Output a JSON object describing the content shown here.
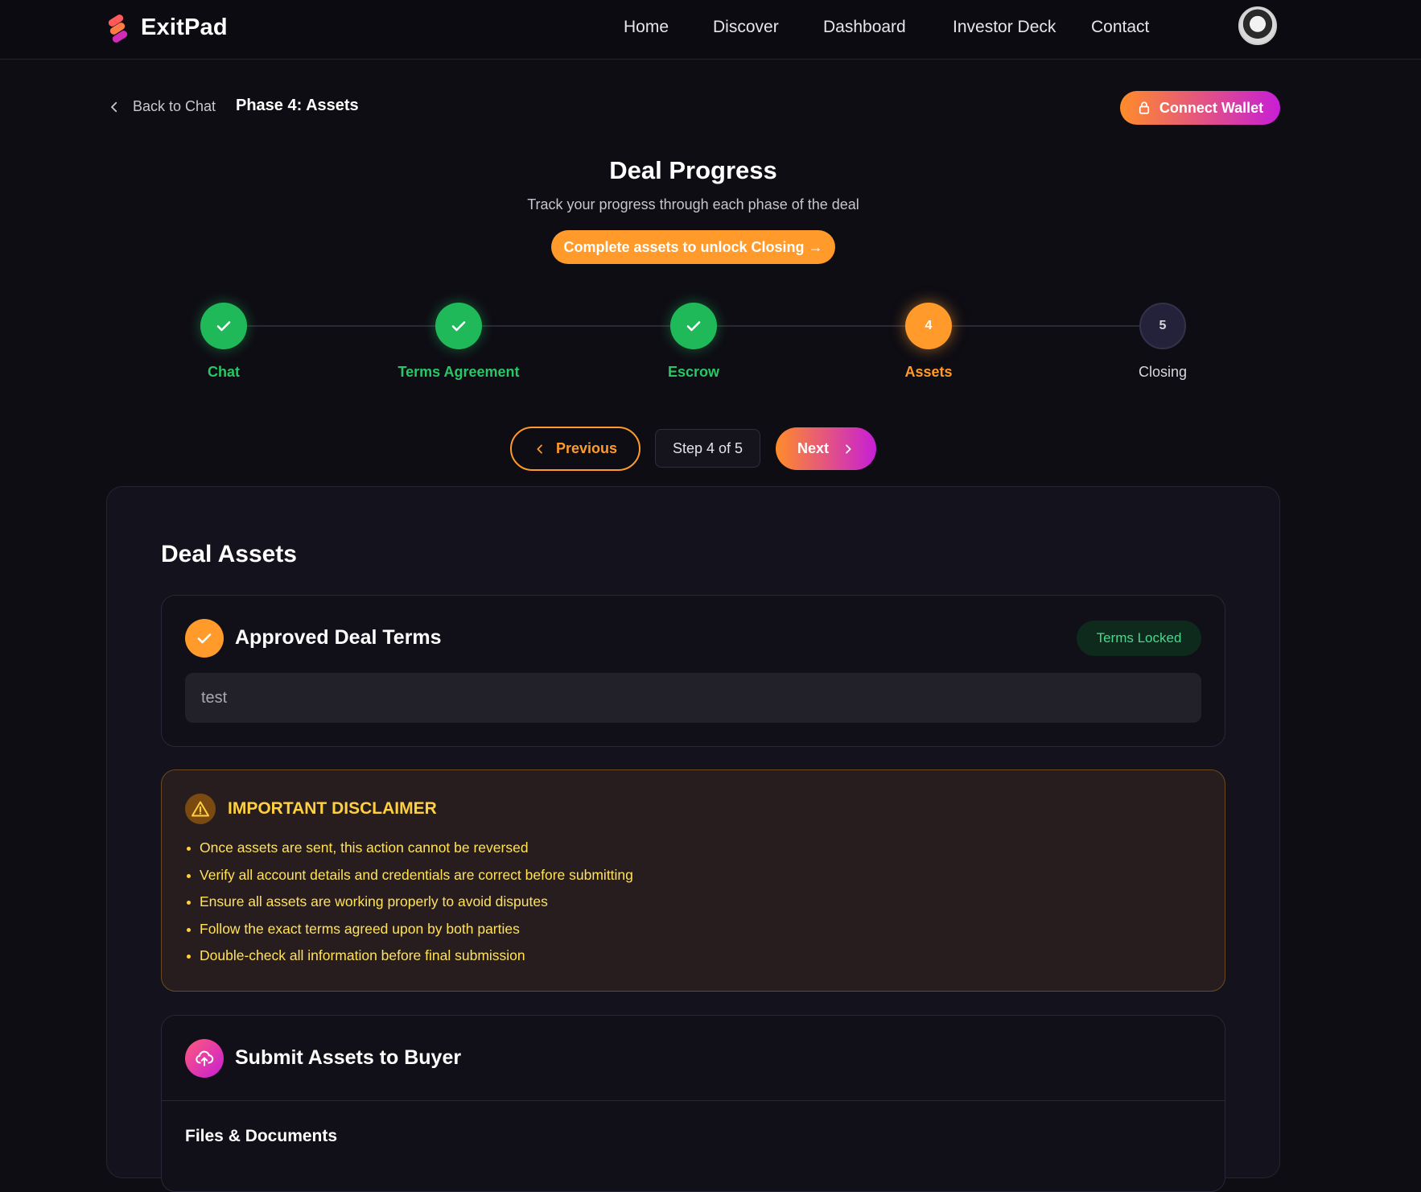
{
  "app": {
    "name": "ExitPad"
  },
  "nav": {
    "items": [
      {
        "label": "Home"
      },
      {
        "label": "Discover"
      },
      {
        "label": "Dashboard"
      },
      {
        "label": "Investor Deck"
      },
      {
        "label": "Contact"
      }
    ]
  },
  "header": {
    "back_label": "Back to Chat",
    "phase_label": "Phase 4: Assets",
    "wallet_label": "Connect Wallet"
  },
  "progress": {
    "title": "Deal Progress",
    "subtitle": "Track your progress through each phase of the deal",
    "unlock_label": "Complete assets to unlock Closing →",
    "steps": [
      {
        "label": "Chat",
        "state": "done",
        "number": ""
      },
      {
        "label": "Terms Agreement",
        "state": "done",
        "number": ""
      },
      {
        "label": "Escrow",
        "state": "done",
        "number": ""
      },
      {
        "label": "Assets",
        "state": "active",
        "number": "4"
      },
      {
        "label": "Closing",
        "state": "pending",
        "number": "5"
      }
    ],
    "prev_label": "Previous",
    "step_count": "Step 4 of 5",
    "next_label": "Next"
  },
  "assets": {
    "title": "Deal Assets",
    "terms": {
      "heading": "Approved Deal Terms",
      "badge": "Terms Locked",
      "value": "test"
    },
    "disclaimer": {
      "title": "IMPORTANT DISCLAIMER",
      "items": [
        "Once assets are sent, this action cannot be reversed",
        "Verify all account details and credentials are correct before submitting",
        "Ensure all assets are working properly to avoid disputes",
        "Follow the exact terms agreed upon by both parties",
        "Double-check all information before final submission"
      ]
    },
    "submit": {
      "heading": "Submit Assets to Buyer",
      "files_title": "Files & Documents"
    }
  },
  "colors": {
    "accent_orange": "#ff9a2b",
    "accent_purple": "#c71ed6",
    "success_green": "#1fb95a",
    "warning_yellow": "#ffd040"
  }
}
